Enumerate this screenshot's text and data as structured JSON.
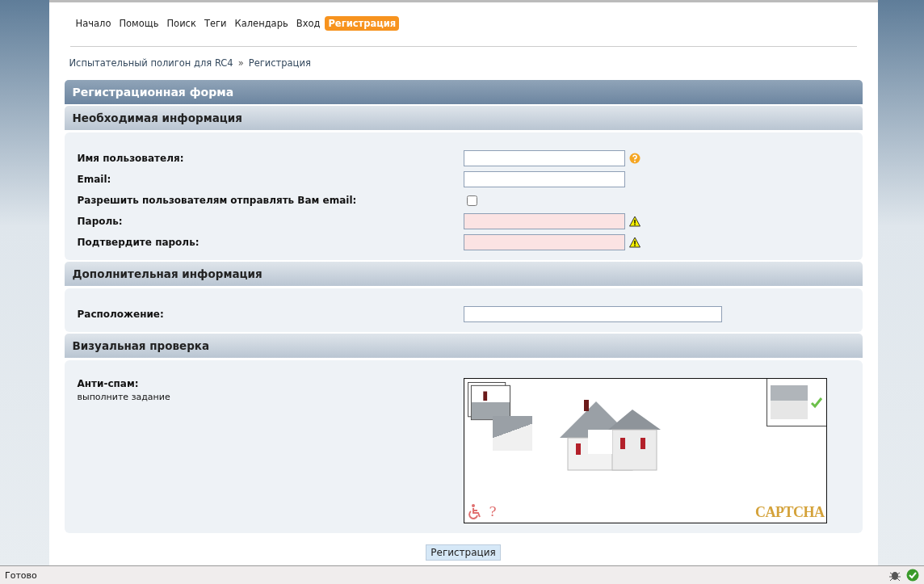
{
  "nav": [
    {
      "label": "Начало",
      "selected": false
    },
    {
      "label": "Помощь",
      "selected": false
    },
    {
      "label": "Поиск",
      "selected": false
    },
    {
      "label": "Теги",
      "selected": false
    },
    {
      "label": "Календарь",
      "selected": false
    },
    {
      "label": "Вход",
      "selected": false
    },
    {
      "label": "Регистрация",
      "selected": true
    }
  ],
  "breadcrumb": [
    {
      "label": "Испытательный полигон для RC4"
    },
    {
      "separator": "»",
      "label": "Регистрация"
    }
  ],
  "form_title": "Регистрационная форма",
  "sections": [
    {
      "title": "Необходимая информация",
      "fields": [
        {
          "kind": "username",
          "label": "Имя пользователя:",
          "invalid": false
        },
        {
          "kind": "text",
          "label": "Email:",
          "invalid": false
        },
        {
          "kind": "checkbox",
          "label": "Разрешить пользователям отправлять Вам email:",
          "checked": false
        },
        {
          "kind": "password",
          "label": "Пароль:",
          "invalid": true
        },
        {
          "kind": "password",
          "label": "Подтвердите пароль:",
          "invalid": true
        }
      ]
    },
    {
      "title": "Дополнительная информация",
      "fields": [
        {
          "kind": "wide-text",
          "label": "Расположение:",
          "invalid": false
        }
      ]
    },
    {
      "title": "Визуальная проверка",
      "fields": [
        {
          "kind": "captcha",
          "label": "Анти-спам:",
          "hint": "выполните задание",
          "help_mark": "?",
          "logo": "CAPTCHA"
        }
      ]
    }
  ],
  "submit": "Регистрация",
  "status_bar": {
    "text": "Готово"
  }
}
